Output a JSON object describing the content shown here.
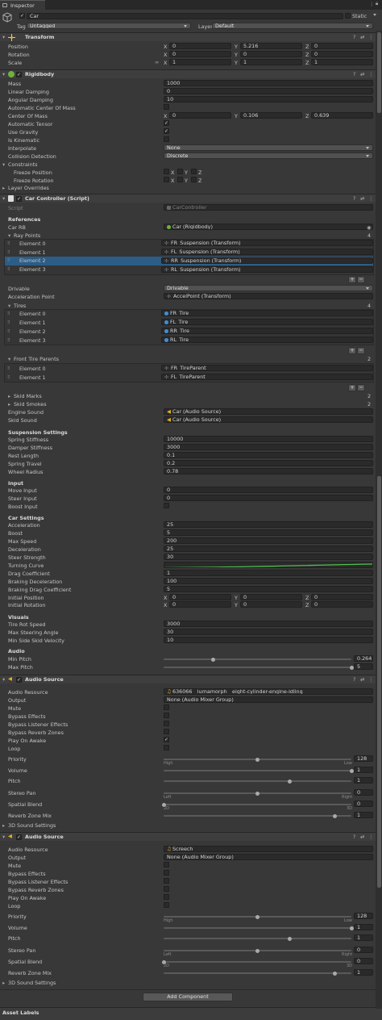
{
  "window": {
    "tab_label": "Inspector",
    "menu_icon": "kebab-icon",
    "lock_icon": "lock-icon"
  },
  "header": {
    "object_name": "Car",
    "static_label": "Static",
    "tag_label": "Tag",
    "tag_value": "Untagged",
    "layer_label": "Layer",
    "layer_value": "Default"
  },
  "transform": {
    "title": "Transform",
    "position": {
      "label": "Position",
      "x": "0",
      "y": "5.216",
      "z": "0"
    },
    "rotation": {
      "label": "Rotation",
      "x": "0",
      "y": "0",
      "z": "0"
    },
    "scale": {
      "label": "Scale",
      "x": "1",
      "y": "1",
      "z": "1"
    }
  },
  "axes": {
    "x": "X",
    "y": "Y",
    "z": "Z"
  },
  "rigidbody": {
    "title": "Rigidbody",
    "mass_label": "Mass",
    "mass": "1000",
    "linear_damping_label": "Linear Damping",
    "linear_damping": "0",
    "angular_damping_label": "Angular Damping",
    "angular_damping": "10",
    "auto_com_label": "Automatic Center Of Mass",
    "com_label": "Center Of Mass",
    "com_x": "0",
    "com_y": "0.106",
    "com_z": "0.639",
    "auto_tensor_label": "Automatic Tensor",
    "use_gravity_label": "Use Gravity",
    "is_kinematic_label": "Is Kinematic",
    "interpolate_label": "Interpolate",
    "interpolate": "None",
    "collision_label": "Collision Detection",
    "collision": "Discrete",
    "constraints_label": "Constraints",
    "freeze_pos_label": "Freeze Position",
    "freeze_rot_label": "Freeze Rotation",
    "layer_overrides_label": "Layer Overrides"
  },
  "car_controller": {
    "title": "Car Controller (Script)",
    "script_label": "Script",
    "script_value": "CarController",
    "references_header": "References",
    "car_rb_label": "Car RB",
    "car_rb": "Car (Rigidbody)",
    "ray_points_label": "Ray Points",
    "ray_points_count": "4",
    "ray_points": [
      "FR_Suspension (Transform)",
      "FL_Suspension (Transform)",
      "RR_Suspension (Transform)",
      "RL_Suspension (Transform)"
    ],
    "elements": [
      "Element 0",
      "Element 1",
      "Element 2",
      "Element 3"
    ],
    "drivable_label": "Drivable",
    "drivable": "Drivable",
    "accel_point_label": "Acceleration Point",
    "accel_point": "AccelPoint (Transform)",
    "tires_label": "Tires",
    "tires_count": "4",
    "tires": [
      "FR_Tire",
      "FL_Tire",
      "RR_Tire",
      "RL_Tire"
    ],
    "front_parents_label": "Front Tire Parents",
    "front_parents_count": "2",
    "front_parents": [
      "FR_TireParent",
      "FL_TireParent"
    ],
    "skid_marks_label": "Skid Marks",
    "skid_marks_count": "2",
    "skid_smokes_label": "Skid Smokes",
    "skid_smokes_count": "2",
    "engine_sound_label": "Engine Sound",
    "engine_sound": "Car (Audio Source)",
    "skid_sound_label": "Skid Sound",
    "skid_sound": "Car (Audio Source)",
    "suspension_header": "Suspension Settings",
    "spring_stiffness_label": "Spring Stiffness",
    "spring_stiffness": "10000",
    "damper_stiffness_label": "Damper Stiffness",
    "damper_stiffness": "3000",
    "rest_length_label": "Rest Length",
    "rest_length": "0.1",
    "spring_travel_label": "Spring Travel",
    "spring_travel": "0.2",
    "wheel_radius_label": "Wheel Radius",
    "wheel_radius": "0.78",
    "input_header": "Input",
    "move_input_label": "Move Input",
    "move_input": "0",
    "steer_input_label": "Steer Input",
    "steer_input": "0",
    "boost_input_label": "Boost Input",
    "car_settings_header": "Car Settings",
    "acceleration_label": "Acceleration",
    "acceleration": "25",
    "boost_label": "Boost",
    "boost": "5",
    "max_speed_label": "Max Speed",
    "max_speed": "200",
    "deceleration_label": "Deceleration",
    "deceleration": "25",
    "steer_strength_label": "Steer Strength",
    "steer_strength": "30",
    "turning_curve_label": "Turning Curve",
    "drag_coef_label": "Drag Coefficient",
    "drag_coef": "1",
    "braking_decel_label": "Braking Deceleration",
    "braking_decel": "100",
    "braking_drag_label": "Braking Drag Coefficient",
    "braking_drag": "5",
    "init_pos_label": "Initial Position",
    "init_pos_x": "0",
    "init_pos_y": "0",
    "init_pos_z": "0",
    "init_rot_label": "Initial Rotation",
    "init_rot_x": "0",
    "init_rot_y": "0",
    "init_rot_z": "0",
    "visuals_header": "Visuals",
    "tire_rot_label": "Tire Rot Speed",
    "tire_rot": "3000",
    "max_steer_label": "Max Steering Angle",
    "max_steer": "30",
    "min_skid_label": "Min Side Skid Velocity",
    "min_skid": "10",
    "audio_header": "Audio",
    "min_pitch_label": "Min Pitch",
    "min_pitch": "0.264",
    "min_pitch_pos": 0.264,
    "max_pitch_label": "Max Pitch",
    "max_pitch": "5",
    "max_pitch_pos": 1.0
  },
  "audio_sources": [
    {
      "title": "Audio Source",
      "resource_label": "Audio Resource",
      "resource": "636066__lumamorph__eight-cylinder-engine-idling",
      "output_label": "Output",
      "output": "None (Audio Mixer Group)",
      "mute_label": "Mute",
      "bypass_effects_label": "Bypass Effects",
      "bypass_listener_label": "Bypass Listener Effects",
      "bypass_reverb_label": "Bypass Reverb Zones",
      "play_on_awake_label": "Play On Awake",
      "loop_label": "Loop",
      "priority_label": "Priority",
      "priority": "128",
      "priority_pos": 0.5,
      "high_label": "High",
      "low_label": "Low",
      "volume_label": "Volume",
      "volume": "1",
      "volume_pos": 1.0,
      "pitch_label": "Pitch",
      "pitch": "1",
      "pitch_pos": 0.67,
      "stereo_label": "Stereo Pan",
      "stereo": "0",
      "stereo_pos": 0.5,
      "left_label": "Left",
      "right_label": "Right",
      "spatial_label": "Spatial Blend",
      "spatial": "0",
      "spatial_pos": 0.0,
      "2d_label": "2D",
      "3d_label": "3D",
      "reverb_label": "Reverb Zone Mix",
      "reverb": "1",
      "reverb_pos": 0.91,
      "sound3d_label": "3D Sound Settings"
    },
    {
      "title": "Audio Source",
      "resource_label": "Audio Resource",
      "resource": "Screech",
      "output_label": "Output",
      "output": "None (Audio Mixer Group)",
      "mute_label": "Mute",
      "bypass_effects_label": "Bypass Effects",
      "bypass_listener_label": "Bypass Listener Effects",
      "bypass_reverb_label": "Bypass Reverb Zones",
      "play_on_awake_label": "Play On Awake",
      "loop_label": "Loop",
      "priority_label": "Priority",
      "priority": "128",
      "priority_pos": 0.5,
      "high_label": "High",
      "low_label": "Low",
      "volume_label": "Volume",
      "volume": "1",
      "volume_pos": 1.0,
      "pitch_label": "Pitch",
      "pitch": "1",
      "pitch_pos": 0.67,
      "stereo_label": "Stereo Pan",
      "stereo": "0",
      "stereo_pos": 0.5,
      "left_label": "Left",
      "right_label": "Right",
      "spatial_label": "Spatial Blend",
      "spatial": "0",
      "spatial_pos": 0.0,
      "2d_label": "2D",
      "3d_label": "3D",
      "reverb_label": "Reverb Zone Mix",
      "reverb": "1",
      "reverb_pos": 0.91,
      "sound3d_label": "3D Sound Settings"
    }
  ],
  "footer": {
    "add_component": "Add Component",
    "asset_labels": "Asset Labels"
  },
  "list_buttons": {
    "add": "+",
    "remove": "−"
  },
  "colors": {
    "background": "#383838",
    "field": "#2a2a2a",
    "header": "#3e3e3e",
    "accent_green": "#4ec24e"
  }
}
